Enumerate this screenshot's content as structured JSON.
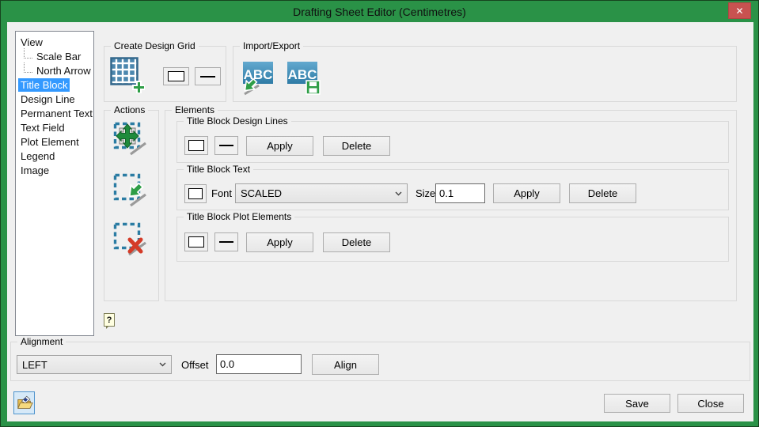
{
  "window": {
    "title": "Drafting Sheet Editor (Centimetres)",
    "close_glyph": "✕"
  },
  "tree": {
    "items": [
      {
        "label": "View",
        "level": 0,
        "selected": false
      },
      {
        "label": "Scale Bar",
        "level": 1,
        "selected": false
      },
      {
        "label": "North Arrow",
        "level": 1,
        "selected": false
      },
      {
        "label": "Title Block",
        "level": 0,
        "selected": true
      },
      {
        "label": "Design Line",
        "level": 0,
        "selected": false
      },
      {
        "label": "Permanent Text",
        "level": 0,
        "selected": false
      },
      {
        "label": "Text Field",
        "level": 0,
        "selected": false
      },
      {
        "label": "Plot Element",
        "level": 0,
        "selected": false
      },
      {
        "label": "Legend",
        "level": 0,
        "selected": false
      },
      {
        "label": "Image",
        "level": 0,
        "selected": false
      }
    ]
  },
  "groups": {
    "create_design_grid": {
      "label": "Create Design Grid"
    },
    "import_export": {
      "label": "Import/Export"
    },
    "actions": {
      "label": "Actions"
    },
    "elements": {
      "label": "Elements",
      "design_lines": {
        "label": "Title Block Design Lines",
        "apply": "Apply",
        "delete": "Delete"
      },
      "text": {
        "label": "Title Block Text",
        "font_label": "Font",
        "font_value": "SCALED",
        "size_label": "Size",
        "size_value": "0.1",
        "apply": "Apply",
        "delete": "Delete"
      },
      "plot_elements": {
        "label": "Title Block Plot Elements",
        "apply": "Apply",
        "delete": "Delete"
      }
    },
    "alignment": {
      "label": "Alignment",
      "value": "LEFT",
      "offset_label": "Offset",
      "offset_value": "0.0",
      "align": "Align"
    }
  },
  "footer": {
    "save": "Save",
    "close": "Close"
  },
  "help": {
    "glyph": "?"
  },
  "icons": {
    "abc": "ABC"
  },
  "colors": {
    "titlebar_green": "#2a9247",
    "close_red": "#c85250",
    "selection_blue": "#3399ff",
    "client_bg": "#f0f0f0",
    "action_green": "#2f9e47",
    "action_red": "#d43b28",
    "icon_blue": "#2b7ca3"
  }
}
